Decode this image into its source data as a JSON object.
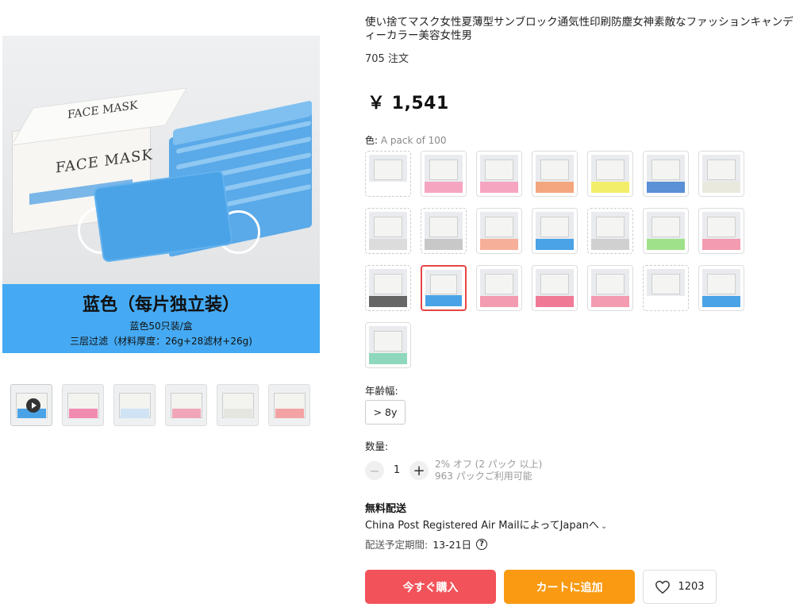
{
  "product": {
    "title": "使い捨てマスク女性夏薄型サンブロック通気性印刷防塵女神素敵なファッションキャンディーカラー美容女性男",
    "orders": "705 注文",
    "price": "￥ 1,541"
  },
  "main_image": {
    "box_label": "FACE MASK",
    "band_title": "蓝色（每片独立装）",
    "band_line1": "蓝色50只装/盒",
    "band_line2": "三层过滤（材料厚度：26g+28滤材+26g)"
  },
  "thumbnails": [
    {
      "name": "thumb-1",
      "video": true,
      "color": "#4aa3e6"
    },
    {
      "name": "thumb-2",
      "color": "#f28bb0"
    },
    {
      "name": "thumb-3",
      "color": "#cfe3f5"
    },
    {
      "name": "thumb-4",
      "color": "#f0a6b8"
    },
    {
      "name": "thumb-5",
      "color": "#e6e6e0"
    },
    {
      "name": "thumb-6",
      "color": "#f3a3a3"
    }
  ],
  "color": {
    "label": "色:",
    "value": "A pack of 100",
    "swatches": [
      {
        "band": "#ffffff",
        "dashed": true
      },
      {
        "band": "#f6a5c0"
      },
      {
        "band": "#f6a5c0"
      },
      {
        "band": "#f4a67e"
      },
      {
        "band": "#f3ee6a"
      },
      {
        "band": "#5b8fd6"
      },
      {
        "band": "#e9e9de"
      },
      {
        "band": "#dcdcdc",
        "dashed": true
      },
      {
        "band": "#c8c8c8",
        "dashed": true
      },
      {
        "band": "#f6b09a"
      },
      {
        "band": "#4aa3e6"
      },
      {
        "band": "#d0d0d0",
        "dashed": true
      },
      {
        "band": "#9fe18a"
      },
      {
        "band": "#f39bb0"
      },
      {
        "band": "#666666",
        "dashed": true
      },
      {
        "band": "#4aa3e6",
        "selected": true
      },
      {
        "band": "#f39bb0"
      },
      {
        "band": "#f07a95"
      },
      {
        "band": "#f39bb0"
      },
      {
        "band": "#ffffff",
        "dashed": true
      },
      {
        "band": "#4aa3e6"
      },
      {
        "band": "#8fd8bd"
      }
    ]
  },
  "age": {
    "label": "年齢幅:",
    "option": "> 8y"
  },
  "quantity": {
    "label": "数量:",
    "minus": "−",
    "value": "1",
    "plus": "+",
    "discount": "2% オフ (2 パック 以上)",
    "available": "963 パックご利用可能"
  },
  "shipping": {
    "title": "無料配送",
    "method": "China Post Registered Air MailによってJapanへ",
    "chevron": "⌄",
    "eta_label": "配送予定期間:",
    "eta_value": "13-21日",
    "help": "?"
  },
  "actions": {
    "buy": "今すぐ購入",
    "cart": "カートに追加",
    "wish_count": "1203"
  }
}
